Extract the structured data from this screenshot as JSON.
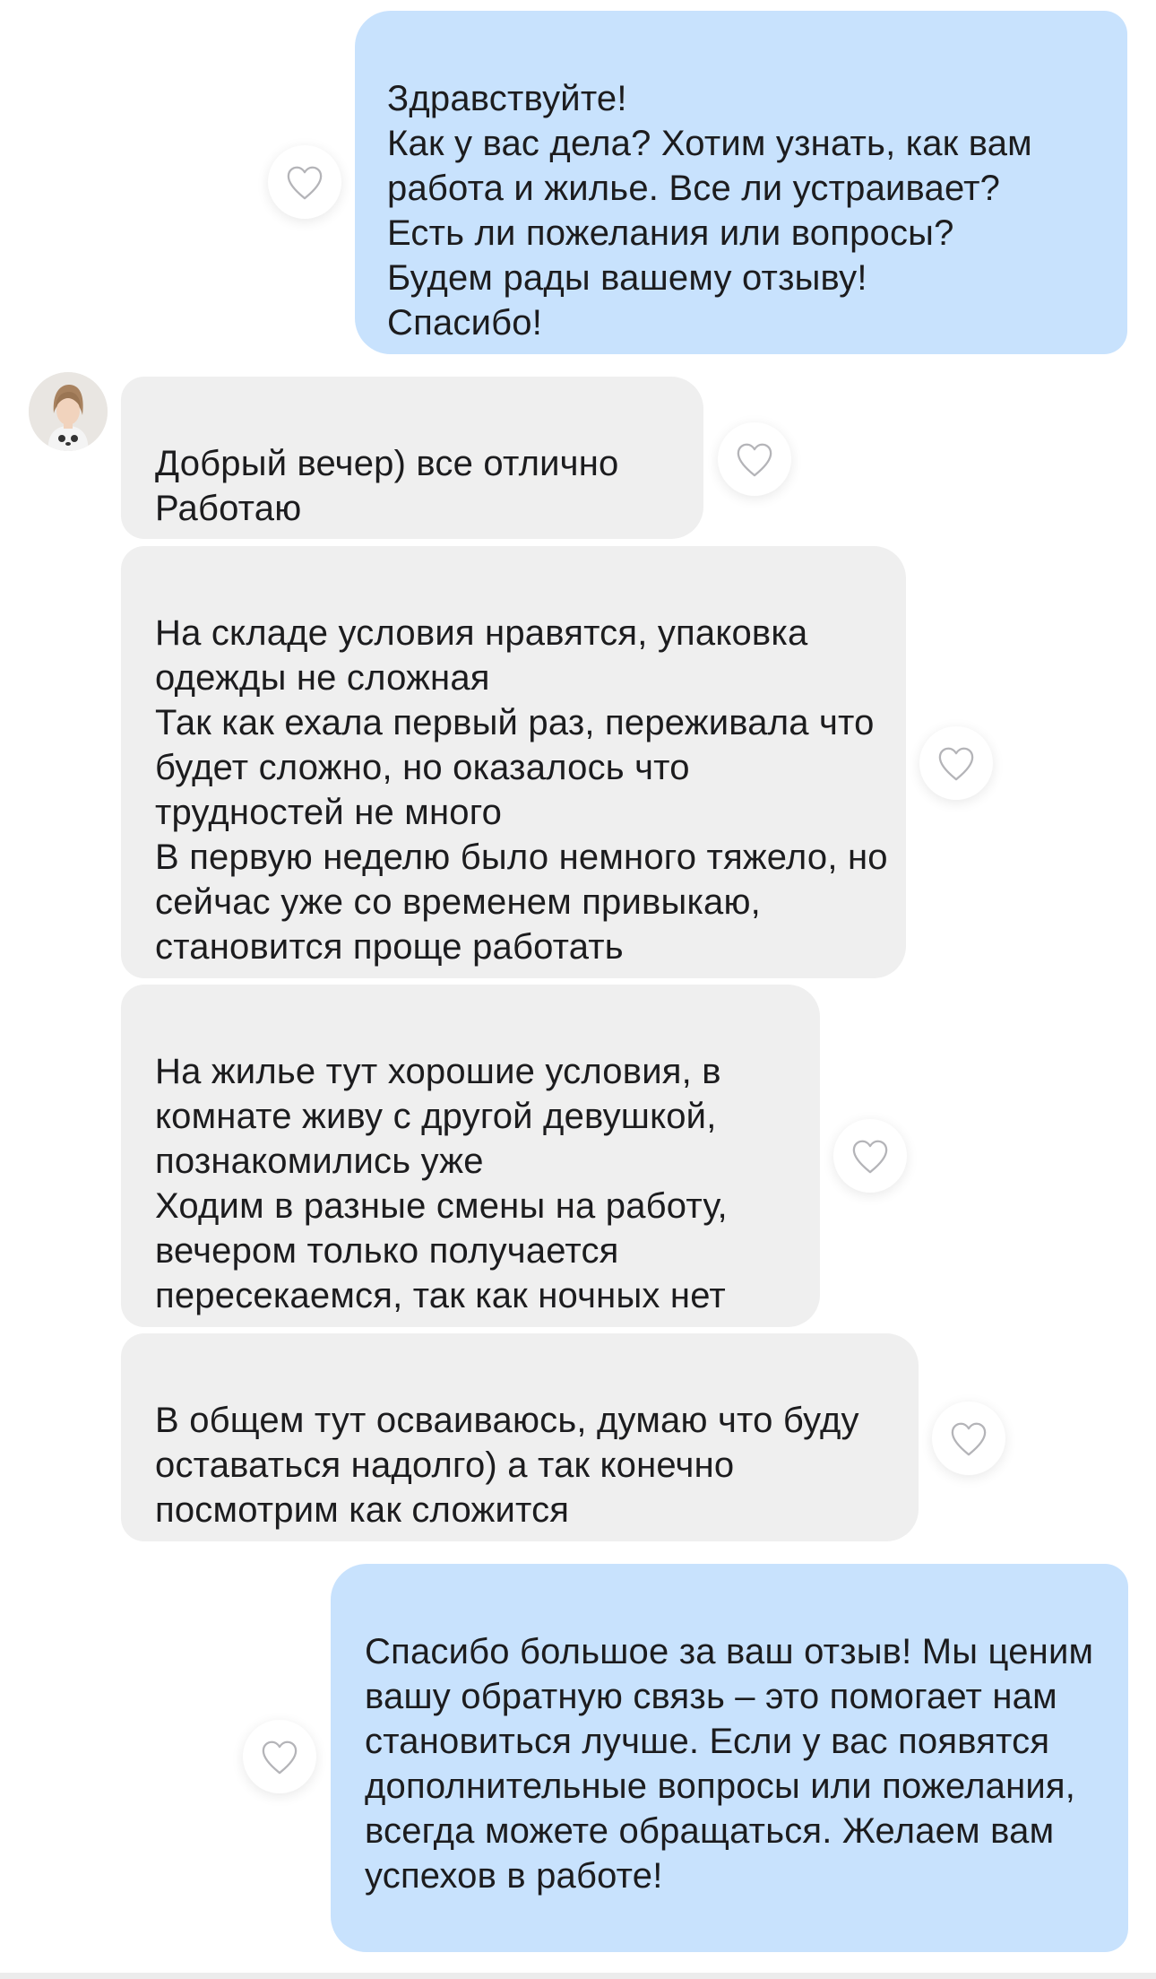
{
  "conversation": {
    "messages": [
      {
        "direction": "outgoing",
        "text": "Здравствуйте!\nКак у вас дела? Хотим узнать, как вам работа и жилье. Все ли устраивает?\nЕсть ли пожелания или вопросы?\nБудем рады вашему отзыву!\nСпасибо!"
      },
      {
        "direction": "incoming",
        "text": "Добрый вечер) все отлично\nРаботаю"
      },
      {
        "direction": "incoming",
        "text": "На складе условия нравятся, упаковка одежды не сложная\nТак как ехала первый раз, переживала что будет сложно, но оказалось что трудностей не много\nВ первую неделю было немного тяжело, но сейчас уже со временем привыкаю, становится проще работать"
      },
      {
        "direction": "incoming",
        "text": "На жилье тут хорошие условия, в комнате живу с другой девушкой, познакомились уже\nХодим в разные смены на работу, вечером только получается пересекаемся, так как ночных нет"
      },
      {
        "direction": "incoming",
        "text": "В общем тут осваиваюсь, думаю что буду оставаться надолго) а так конечно посмотрим как сложится"
      },
      {
        "direction": "outgoing",
        "text": "Спасибо большое за ваш отзыв! Мы ценим вашу обратную связь – это помогает нам становиться лучше. Если у вас появятся дополнительные вопросы или пожелания, всегда можете обращаться. Желаем вам успехов в работе!"
      }
    ]
  },
  "icons": {
    "like": "heart-outline-icon",
    "avatar": "contact-avatar-photo"
  },
  "colors": {
    "outgoing_bubble": "#c8e2fd",
    "incoming_bubble": "#efefef",
    "heart_stroke": "#b4b4b8",
    "text": "#1c1c1e"
  }
}
